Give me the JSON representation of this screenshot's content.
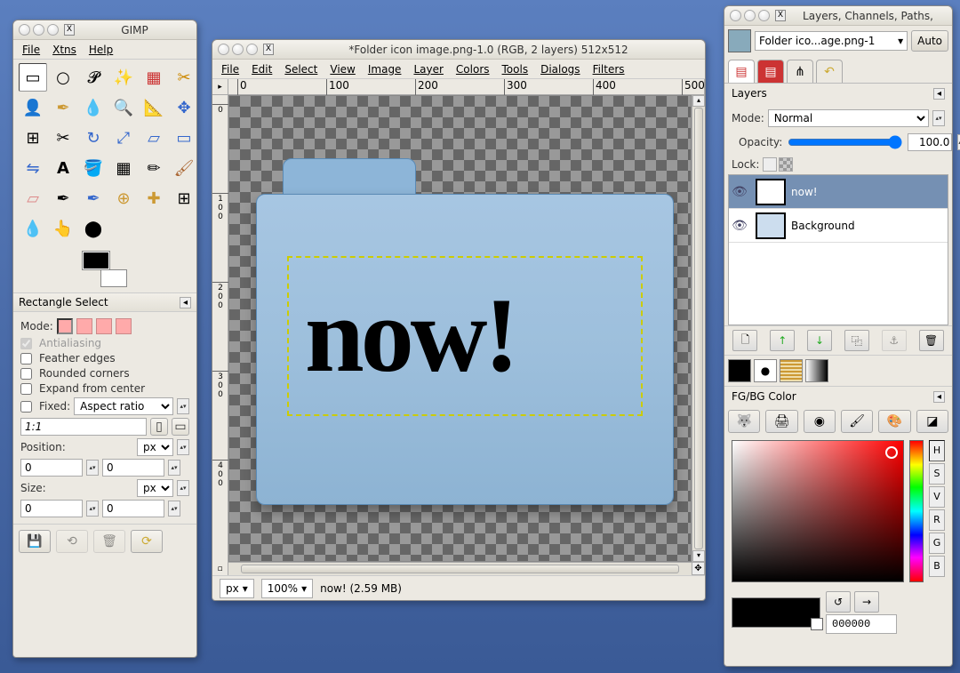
{
  "toolbox": {
    "title": "GIMP",
    "menu": [
      "File",
      "Xtns",
      "Help"
    ],
    "tools": [
      "▭",
      "○",
      "𝓛",
      "✎",
      "⬚",
      "🔍",
      "⬍",
      "⊹",
      "↔",
      "⬌",
      "↻",
      "⤢",
      "✂",
      "⬛",
      "⬛",
      "⮑",
      "✎",
      "A",
      "⊡",
      "⬛",
      "✏",
      "🖌",
      "⬜",
      "✒",
      "▂",
      "⬛",
      "✨",
      "⬤",
      "▽",
      "⬤"
    ],
    "options_header": "Rectangle Select",
    "mode_label": "Mode:",
    "antialiasing": "Antialiasing",
    "feather": "Feather edges",
    "rounded": "Rounded corners",
    "expand": "Expand from center",
    "fixed": "Fixed:",
    "fixed_value": "Aspect ratio",
    "ratio": "1:1",
    "position": "Position:",
    "unit": "px",
    "pos_x": "0",
    "pos_y": "0",
    "size": "Size:",
    "size_w": "0",
    "size_h": "0"
  },
  "canvas": {
    "title": "*Folder icon image.png-1.0 (RGB, 2 layers) 512x512",
    "menu": [
      "File",
      "Edit",
      "Select",
      "View",
      "Image",
      "Layer",
      "Colors",
      "Tools",
      "Dialogs",
      "Filters"
    ],
    "ruler_ticks": [
      "0",
      "100",
      "200",
      "300",
      "400",
      "500"
    ],
    "folder_text": "now!",
    "status_unit": "px",
    "status_zoom": "100%",
    "status_text": "now! (2.59 MB)"
  },
  "layers": {
    "title": "Layers, Channels, Paths,",
    "image_name": "Folder ico...age.png-1",
    "auto": "Auto",
    "panel": "Layers",
    "mode_label": "Mode:",
    "mode_value": "Normal",
    "opacity_label": "Opacity:",
    "opacity_value": "100.0",
    "lock_label": "Lock:",
    "layers_list": [
      {
        "name": "now!",
        "selected": true
      },
      {
        "name": "Background",
        "selected": false
      }
    ],
    "fgbg_header": "FG/BG Color",
    "hsv": [
      "H",
      "S",
      "V",
      "R",
      "G",
      "B"
    ],
    "hex": "000000"
  }
}
